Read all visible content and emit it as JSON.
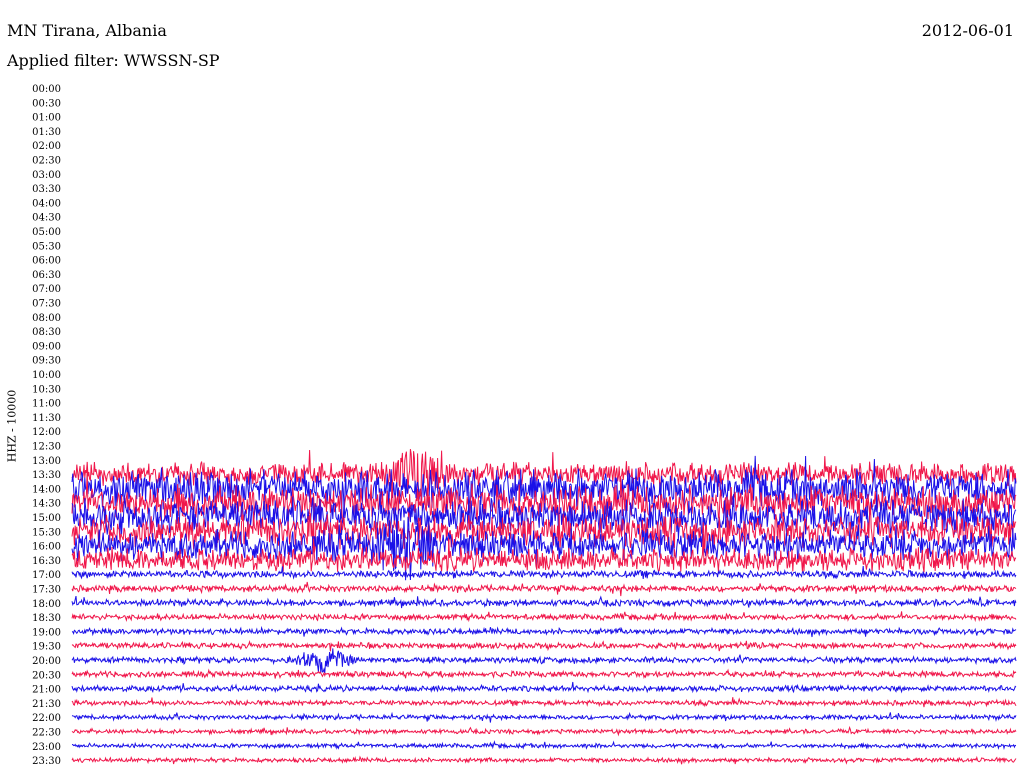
{
  "header": {
    "station": "MN Tirana, Albania",
    "filter": "Applied filter: WWSSN-SP",
    "date": "2012-06-01"
  },
  "chart_data": {
    "type": "line",
    "title": "MN Tirana, Albania",
    "subtitle": "Applied filter: WWSSN-SP",
    "date": "2012-06-01",
    "ylabel": "HHZ - 10000",
    "xlabel": "",
    "grid": false,
    "row_labels": [
      "00:00",
      "00:30",
      "01:00",
      "01:30",
      "02:00",
      "02:30",
      "03:00",
      "03:30",
      "04:00",
      "04:30",
      "05:00",
      "05:30",
      "06:00",
      "06:30",
      "07:00",
      "07:30",
      "08:00",
      "08:30",
      "09:00",
      "09:30",
      "10:00",
      "10:30",
      "11:00",
      "11:30",
      "12:00",
      "12:30",
      "13:00",
      "13:30",
      "14:00",
      "14:30",
      "15:00",
      "15:30",
      "16:00",
      "16:30",
      "17:00",
      "17:30",
      "18:00",
      "18:30",
      "19:00",
      "19:30",
      "20:00",
      "20:30",
      "21:00",
      "21:30",
      "22:00",
      "22:30",
      "23:00",
      "23:30"
    ],
    "trace_colors": [
      "#1a10e8",
      "#f0164a"
    ],
    "series": [
      {
        "row": "13:30",
        "level": 0.55
      },
      {
        "row": "14:00",
        "level": 0.9
      },
      {
        "row": "14:30",
        "level": 0.85
      },
      {
        "row": "15:00",
        "level": 0.85
      },
      {
        "row": "15:30",
        "level": 0.8
      },
      {
        "row": "16:00",
        "level": 0.75
      },
      {
        "row": "16:30",
        "level": 0.55
      },
      {
        "row": "17:00",
        "level": 0.14
      },
      {
        "row": "17:30",
        "level": 0.12
      },
      {
        "row": "18:00",
        "level": 0.12
      },
      {
        "row": "18:30",
        "level": 0.1
      },
      {
        "row": "19:00",
        "level": 0.1
      },
      {
        "row": "19:30",
        "level": 0.1
      },
      {
        "row": "20:00",
        "level": 0.1
      },
      {
        "row": "20:30",
        "level": 0.1
      },
      {
        "row": "21:00",
        "level": 0.1
      },
      {
        "row": "21:30",
        "level": 0.08
      },
      {
        "row": "22:00",
        "level": 0.07
      },
      {
        "row": "22:30",
        "level": 0.06
      },
      {
        "row": "23:00",
        "level": 0.06
      },
      {
        "row": "23:30",
        "level": 0.06
      }
    ],
    "events": [
      {
        "row": "16:00",
        "time_min": 10.5,
        "amp": 1.0
      },
      {
        "row": "13:30",
        "time_min": 11.0,
        "amp": 1.0
      },
      {
        "row": "20:00",
        "time_min": 8.0,
        "amp": 0.5
      }
    ]
  }
}
